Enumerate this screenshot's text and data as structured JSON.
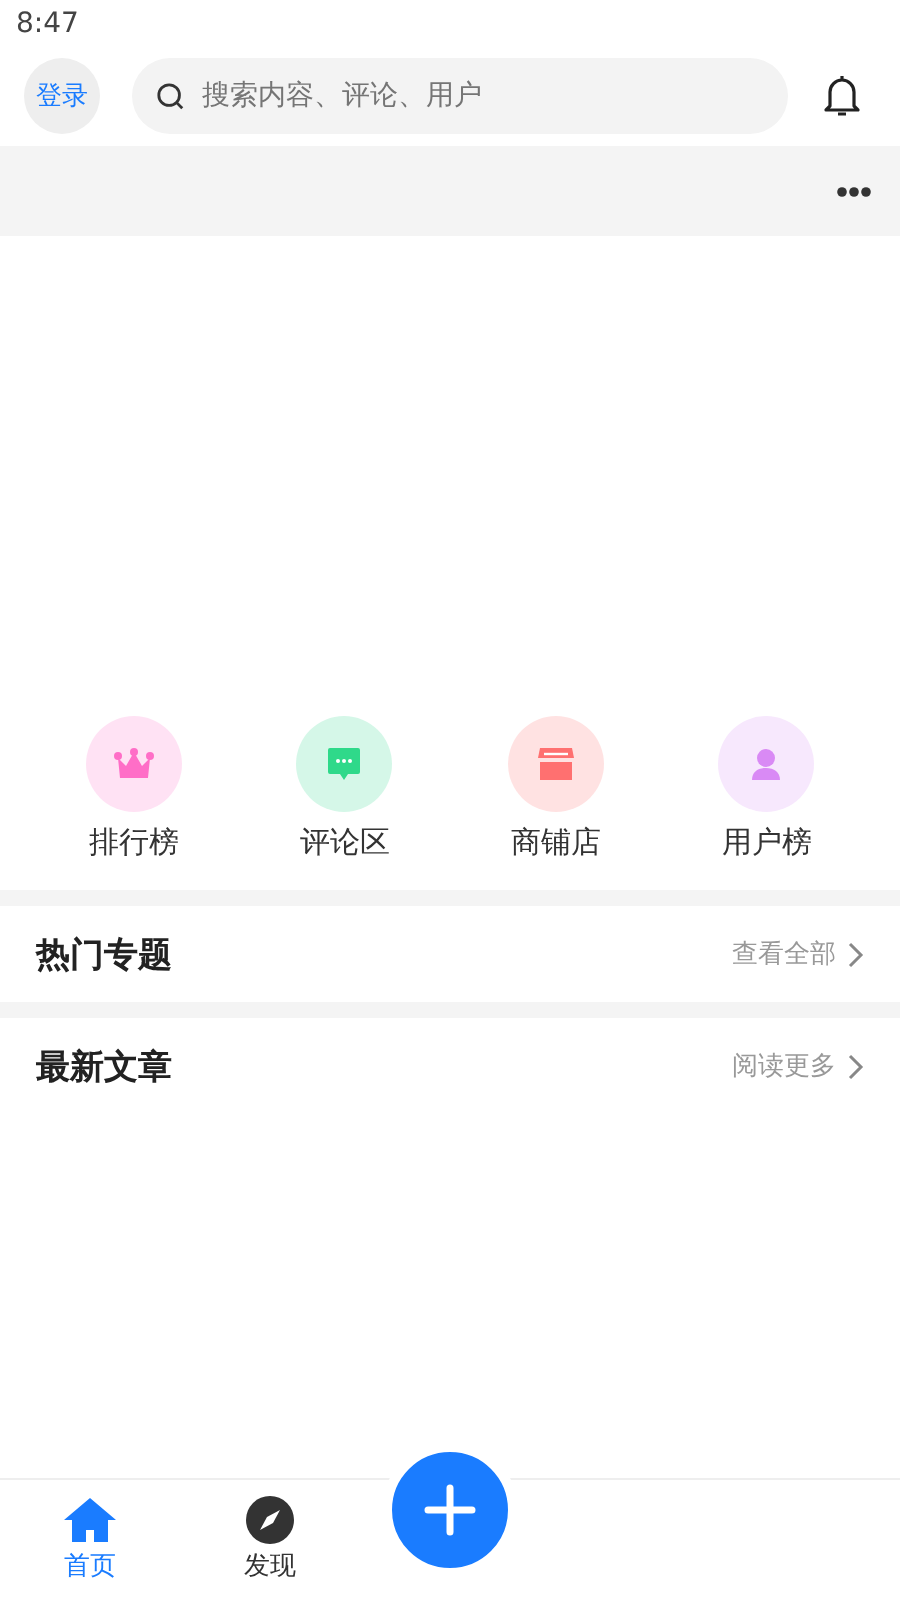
{
  "status_bar": {
    "time": "8:47"
  },
  "header": {
    "login": "登录",
    "search": {
      "placeholder": "搜索内容、评论、用户"
    }
  },
  "shortcuts": [
    {
      "label": "排行榜",
      "kind": "crown",
      "color": "#ff6ec7"
    },
    {
      "label": "评论区",
      "kind": "comment",
      "color": "#2fd98a"
    },
    {
      "label": "商铺店",
      "kind": "shop",
      "color": "#ff7070"
    },
    {
      "label": "用户榜",
      "kind": "user",
      "color": "#d98af5"
    }
  ],
  "sections": [
    {
      "title": "热门专题",
      "link": "查看全部"
    },
    {
      "title": "最新文章",
      "link": "阅读更多"
    }
  ],
  "tab_bar": [
    {
      "kind": "home",
      "label": "首页",
      "selected": true
    },
    {
      "kind": "discover",
      "label": "发现",
      "selected": false
    },
    {
      "kind": "add"
    }
  ]
}
